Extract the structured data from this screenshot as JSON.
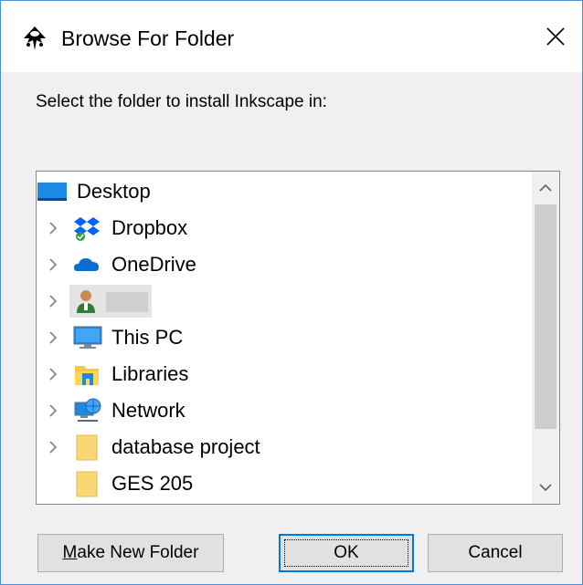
{
  "window": {
    "title": "Browse For Folder",
    "close_label": "×",
    "app_icon": "inkscape-icon"
  },
  "prompt": "Select the folder to install Inkscape in:",
  "tree": {
    "root": {
      "label": "Desktop",
      "icon": "desktop-icon"
    },
    "items": [
      {
        "label": "Dropbox",
        "icon": "dropbox-icon",
        "expandable": true
      },
      {
        "label": "OneDrive",
        "icon": "onedrive-icon",
        "expandable": true
      },
      {
        "label": "",
        "icon": "user-icon",
        "expandable": true,
        "redacted": true
      },
      {
        "label": "This PC",
        "icon": "computer-icon",
        "expandable": true
      },
      {
        "label": "Libraries",
        "icon": "libraries-icon",
        "expandable": true
      },
      {
        "label": "Network",
        "icon": "network-icon",
        "expandable": true
      },
      {
        "label": "database project",
        "icon": "folder-icon",
        "expandable": true
      },
      {
        "label": "GES 205",
        "icon": "folder-icon",
        "expandable": false
      }
    ]
  },
  "buttons": {
    "make_new_folder_first": "M",
    "make_new_folder_rest": "ake New Folder",
    "ok": "OK",
    "cancel": "Cancel"
  },
  "colors": {
    "window_border": "#4f8fd6",
    "button_focus": "#0078d7"
  }
}
